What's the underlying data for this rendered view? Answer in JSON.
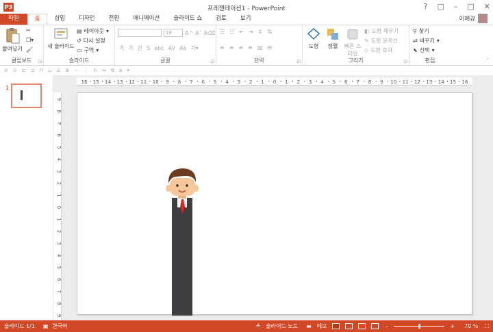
{
  "window": {
    "title": "프레젠테이션1 - PowerPoint",
    "app_badge": "P3",
    "user": "이혜강"
  },
  "tabs": [
    "파일",
    "홈",
    "삽입",
    "디자인",
    "전환",
    "애니메이션",
    "슬라이드 쇼",
    "검토",
    "보기"
  ],
  "ribbon": {
    "clipboard": {
      "paste": "붙여넣기",
      "label": "클립보드"
    },
    "slides": {
      "new_slide": "새 슬라이드",
      "layout": "레이아웃",
      "reset": "다시 설정",
      "section": "구역",
      "label": "슬라이드"
    },
    "font": {
      "size": "18",
      "label": "글꼴"
    },
    "paragraph": {
      "label": "단락"
    },
    "drawing": {
      "shapes": "도형",
      "arrange": "정렬",
      "quick_styles": "빠른 스타일",
      "fill": "도형 채우기",
      "outline": "도형 윤곽선",
      "effects": "도형 효과",
      "label": "그리기"
    },
    "editing": {
      "find": "찾기",
      "replace": "바꾸기",
      "select": "선택",
      "label": "편집"
    }
  },
  "rulers": {
    "horizontal": [
      "16",
      "15",
      "14",
      "13",
      "12",
      "11",
      "10",
      "9",
      "8",
      "7",
      "6",
      "5",
      "4",
      "3",
      "2",
      "1",
      "0",
      "1",
      "2",
      "3",
      "4",
      "5",
      "6",
      "7",
      "8",
      "9",
      "10",
      "11",
      "12",
      "13",
      "14",
      "15",
      "16"
    ],
    "vertical": [
      "9",
      "8",
      "7",
      "6",
      "5",
      "4",
      "3",
      "2",
      "1",
      "0",
      "1",
      "2",
      "3",
      "4",
      "5",
      "6",
      "7",
      "8",
      "9"
    ]
  },
  "thumbnails": [
    {
      "number": "1"
    }
  ],
  "status": {
    "slide": "슬라이드 1/1",
    "language": "한국어",
    "notes": "슬라이드 노트",
    "comments": "메모",
    "zoom": "70 %",
    "zoom_level": 0.7
  },
  "colors": {
    "accent": "#d24726",
    "suit": "#3e3d40",
    "hair": "#6b3b1e",
    "skin": "#f5c79b",
    "tie": "#e0201b"
  }
}
